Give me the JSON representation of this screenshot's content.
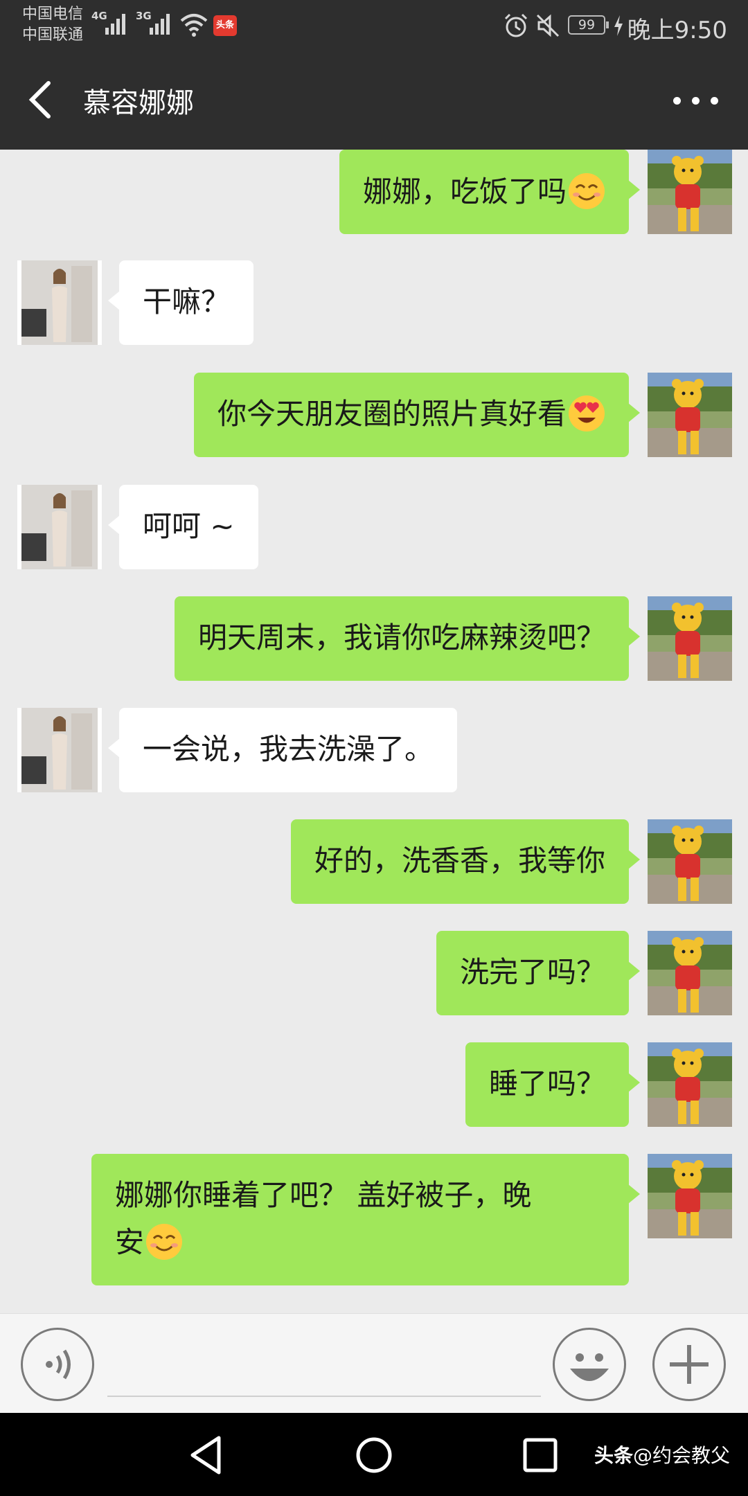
{
  "status_bar": {
    "carrier_1": "中国电信",
    "carrier_2": "中国联通",
    "net_1": "4G",
    "net_2": "3G",
    "app_badge": "头条",
    "battery": "99",
    "time": "晚上9:50"
  },
  "header": {
    "title": "慕容娜娜"
  },
  "messages": [
    {
      "sender": "me",
      "text": "娜娜，吃饭了吗",
      "emoji": "smile"
    },
    {
      "sender": "them",
      "text": "干嘛？"
    },
    {
      "sender": "me",
      "text": "你今天朋友圈的照片真好看",
      "emoji": "heart-eyes"
    },
    {
      "sender": "them",
      "text": "呵呵 ~"
    },
    {
      "sender": "me",
      "text": "明天周末，我请你吃麻辣烫吧？"
    },
    {
      "sender": "them",
      "text": "一会说，我去洗澡了。"
    },
    {
      "sender": "me",
      "text": "好的，洗香香，我等你"
    },
    {
      "sender": "me",
      "text": "洗完了吗？"
    },
    {
      "sender": "me",
      "text": "睡了吗？"
    },
    {
      "sender": "me",
      "text_line_1": "娜娜你睡着了吧？ 盖好被子，晚",
      "text_line_2": "安",
      "emoji": "smile"
    }
  ],
  "input": {
    "placeholder": ""
  },
  "watermark": {
    "brand": "头条",
    "handle": "@约会教父"
  },
  "colors": {
    "my_bubble": "#a0e75a",
    "their_bubble": "#ffffff",
    "chat_background": "#ebebeb",
    "header_background": "#2e2e2e"
  }
}
